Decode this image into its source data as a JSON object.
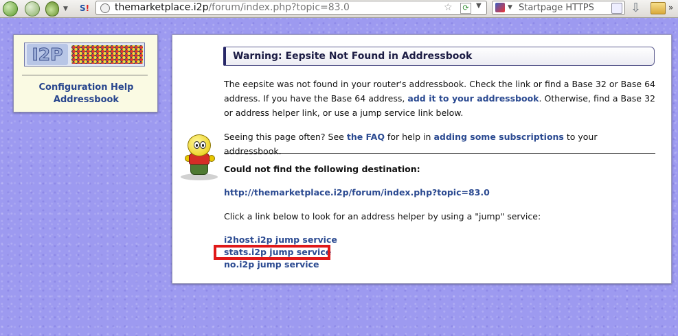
{
  "browser": {
    "url_host": "themarketplace.i2p",
    "url_path": "/forum/index.php?topic=83.0",
    "noscript_label": "S",
    "noscript_mark": "!",
    "search_engine": "Startpage HTTPS"
  },
  "sidebar": {
    "logo_text": "I2P",
    "config_link_line1": "Configuration Help",
    "config_link_line2": "Addressbook"
  },
  "main": {
    "warning_title": "Warning: Eepsite Not Found in Addressbook",
    "p1_before": "The eepsite was not found in your router's addressbook. Check the link or find a Base 32 or Base 64 address. If you have the Base 64 address, ",
    "p1_link": "add it to your addressbook",
    "p1_after": ". Otherwise, find a Base 32 or address helper link, or use a jump service link below.",
    "p2_before": "Seeing this page often? See ",
    "p2_faq_link": "the FAQ",
    "p2_middle": " for help in ",
    "p2_subs_link": "adding some subscriptions",
    "p2_after": " to your addressbook.",
    "not_found_label": "Could not find the following destination:",
    "destination_url": "http://themarketplace.i2p/forum/index.php?topic=83.0",
    "jump_instructions": "Click a link below to look for an address helper by using a \"jump\" service:",
    "jump_links": [
      "i2host.i2p jump service",
      "stats.i2p jump service",
      "no.i2p jump service"
    ],
    "highlight_color": "#e01818"
  }
}
